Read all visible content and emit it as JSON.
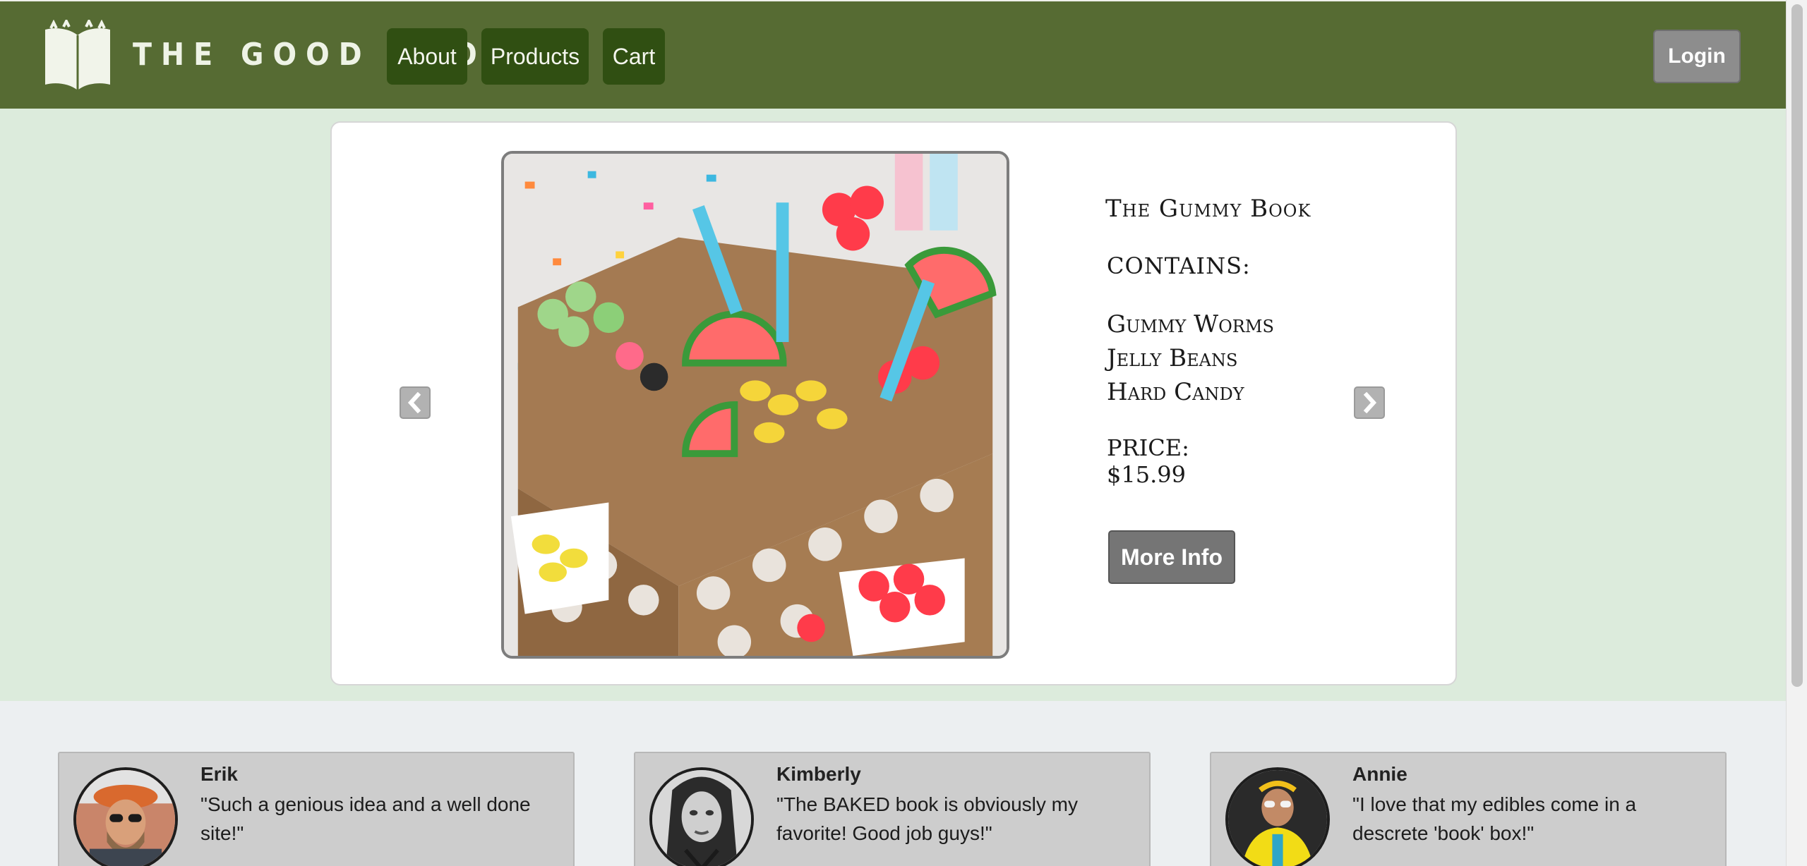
{
  "header": {
    "brand": "THE GOOD BOOK",
    "nav": [
      {
        "label": "About"
      },
      {
        "label": "Products"
      },
      {
        "label": "Cart"
      }
    ],
    "login_label": "Login"
  },
  "product": {
    "title": "The Gummy Book",
    "contains_label": "CONTAINS:",
    "contents": [
      "Gummy Worms",
      "Jelly Beans",
      "Hard Candy"
    ],
    "price_label": "PRICE:",
    "price": "$15.99",
    "more_info_label": "More Info"
  },
  "testimonials": [
    {
      "name": "Erik",
      "quote": "\"Such a genious idea and a well done site!\""
    },
    {
      "name": "Kimberly",
      "quote": "\"The BAKED book is obviously my favorite! Good job guys!\""
    },
    {
      "name": "Annie",
      "quote": "\"I love that my edibles come in a descrete 'book' box!\""
    }
  ],
  "colors": {
    "header": "#566b33",
    "nav_button": "#304f12",
    "hero_band": "#dcebdc",
    "button_gray": "#757575"
  },
  "icons": {
    "logo": "open-book-icon",
    "prev": "chevron-left-icon",
    "next": "chevron-right-icon"
  }
}
